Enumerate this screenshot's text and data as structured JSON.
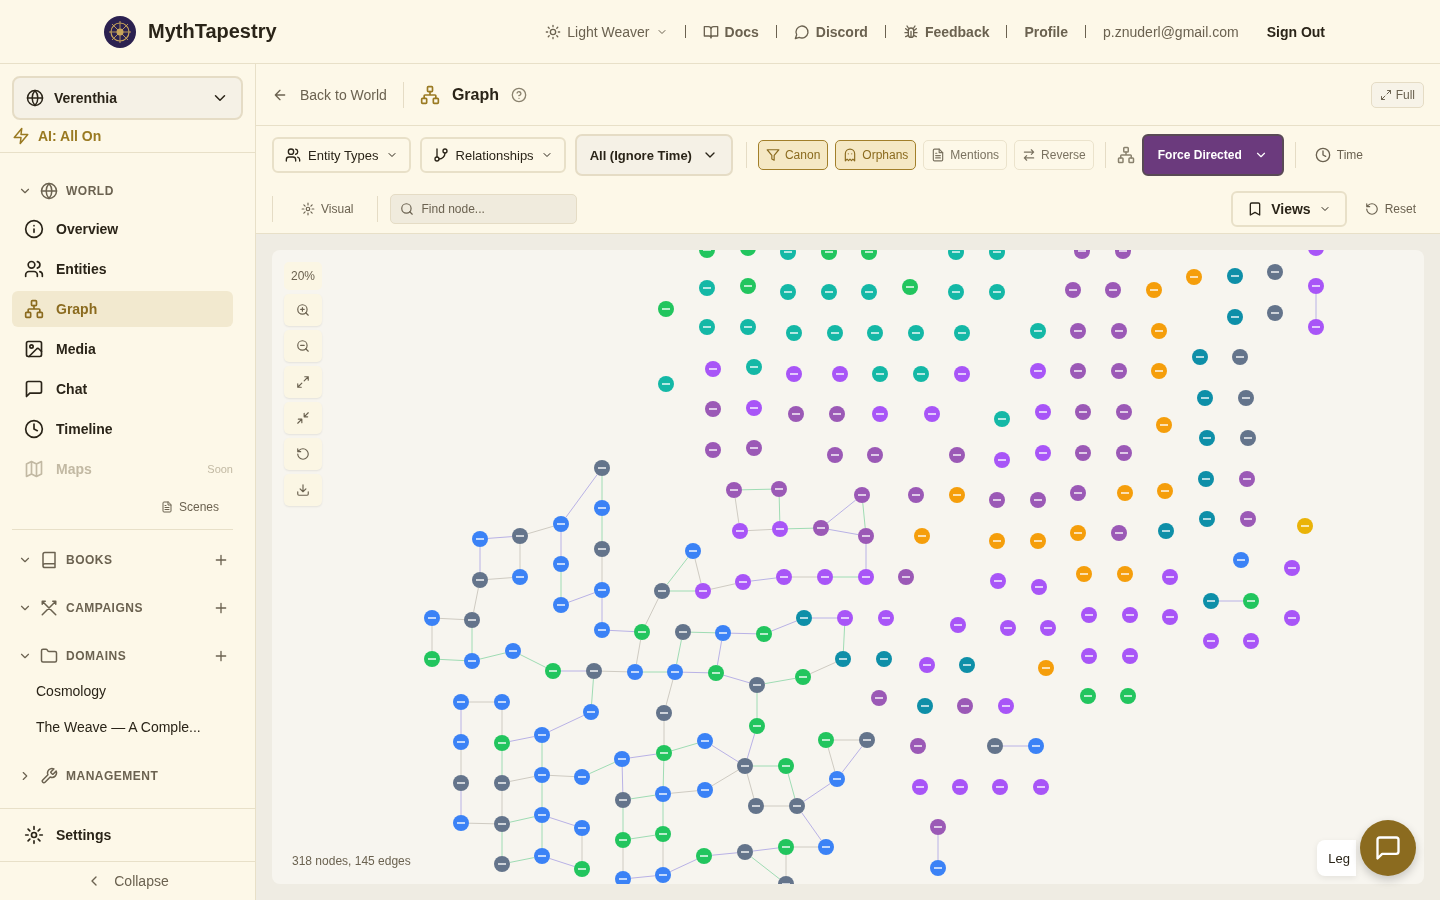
{
  "header": {
    "brand": "MythTapestry",
    "theme": "Light Weaver",
    "links": [
      {
        "label": "Docs"
      },
      {
        "label": "Discord"
      },
      {
        "label": "Feedback"
      },
      {
        "label": "Profile"
      }
    ],
    "email": "p.znuderl@gmail.com",
    "sign_out": "Sign Out"
  },
  "sidebar": {
    "world": "Verenthia",
    "ai_status": "AI: All On",
    "world_section": {
      "title": "WORLD",
      "expanded": true
    },
    "nav": [
      {
        "label": "Overview",
        "selected": false,
        "disabled": false
      },
      {
        "label": "Entities",
        "selected": false,
        "disabled": false
      },
      {
        "label": "Graph",
        "selected": true,
        "disabled": false
      },
      {
        "label": "Media",
        "selected": false,
        "disabled": false
      },
      {
        "label": "Chat",
        "selected": false,
        "disabled": false
      },
      {
        "label": "Timeline",
        "selected": false,
        "disabled": false
      },
      {
        "label": "Maps",
        "selected": false,
        "disabled": true,
        "badge": "Soon"
      }
    ],
    "scenes": "Scenes",
    "sections": [
      {
        "title": "BOOKS",
        "expanded": true,
        "addable": true
      },
      {
        "title": "CAMPAIGNS",
        "expanded": true,
        "addable": true
      },
      {
        "title": "DOMAINS",
        "expanded": true,
        "addable": true,
        "children": [
          {
            "label": "Cosmology"
          },
          {
            "label": "The Weave — A Comple..."
          }
        ]
      },
      {
        "title": "MANAGEMENT",
        "expanded": false,
        "addable": false
      }
    ],
    "settings": "Settings",
    "collapse": "Collapse"
  },
  "page": {
    "back": "Back to World",
    "title": "Graph",
    "full": "Full"
  },
  "toolbar": {
    "dropdowns": [
      {
        "label": "Entity Types"
      },
      {
        "label": "Relationships"
      }
    ],
    "time_filter": "All (Ignore Time)",
    "toggles": [
      {
        "label": "Canon",
        "selected": true
      },
      {
        "label": "Orphans",
        "selected": true
      },
      {
        "label": "Mentions",
        "selected": false
      },
      {
        "label": "Reverse",
        "selected": false
      }
    ],
    "layout": "Force Directed",
    "time": "Time",
    "visual": "Visual",
    "search": {
      "placeholder": "Find node..."
    },
    "views": "Views",
    "reset": "Reset"
  },
  "canvas": {
    "zoom": "20%",
    "stats": "318 nodes, 145 edges",
    "legend": "Leg"
  }
}
